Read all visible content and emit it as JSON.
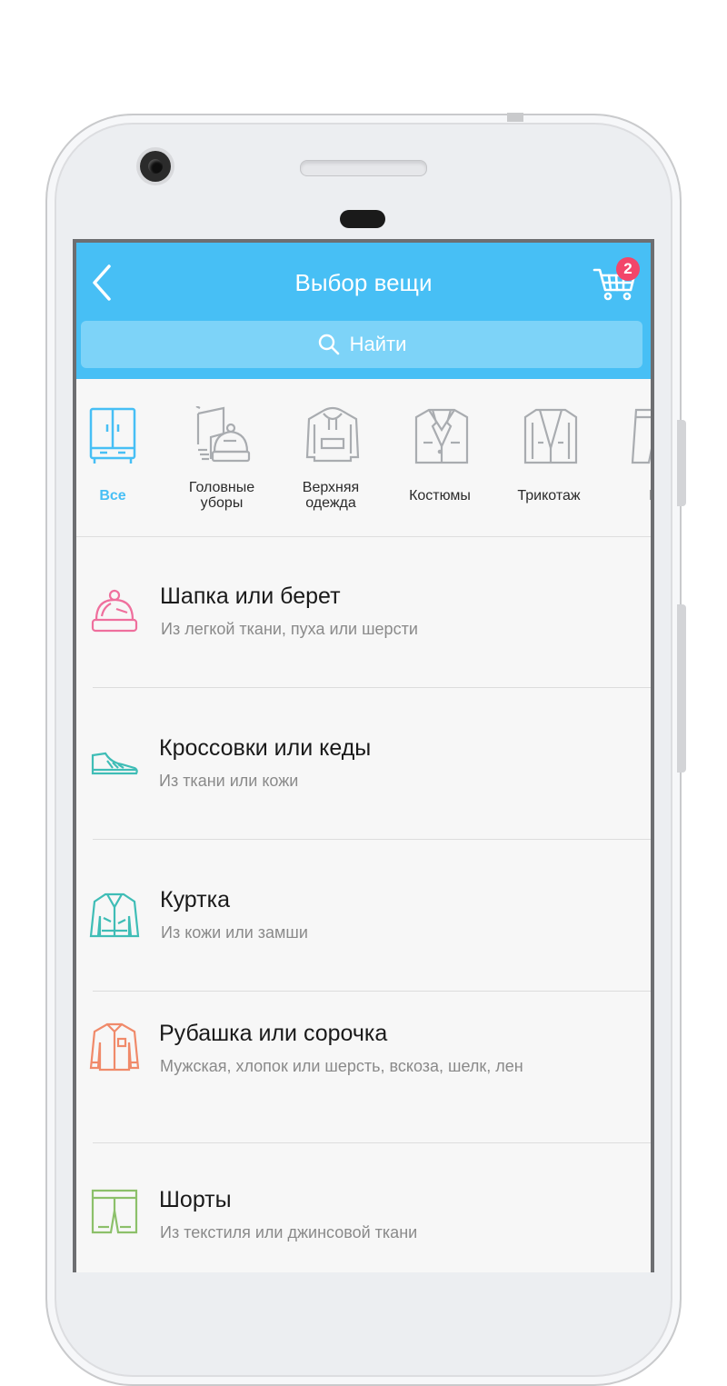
{
  "header": {
    "title": "Выбор вещи",
    "cart_count": "2"
  },
  "search": {
    "placeholder": "Найти"
  },
  "categories": [
    {
      "label": "Все",
      "icon": "wardrobe-icon",
      "active": true
    },
    {
      "label": "Головные\nуборы",
      "icon": "hat-scarf-icon",
      "active": false
    },
    {
      "label": "Верхняя\nодежда",
      "icon": "hoodie-icon",
      "active": false
    },
    {
      "label": "Костюмы",
      "icon": "suit-jacket-icon",
      "active": false
    },
    {
      "label": "Трикотаж",
      "icon": "cardigan-icon",
      "active": false
    },
    {
      "label": "Бр",
      "icon": "trousers-icon",
      "active": false
    }
  ],
  "items": [
    {
      "title": "Шапка или берет",
      "subtitle": "Из легкой ткани, пуха или шерсти",
      "icon": "beanie-icon",
      "color": "#ef6f9d"
    },
    {
      "title": "Кроссовки или кеды",
      "subtitle": "Из ткани или кожи",
      "icon": "sneaker-icon",
      "color": "#3fbdb6"
    },
    {
      "title": "Куртка",
      "subtitle": "Из кожи или замши",
      "icon": "jacket-icon",
      "color": "#3fbdb6"
    },
    {
      "title": "Рубашка или сорочка",
      "subtitle": "Мужская, хлопок или шерсть, вскоза, шелк, лен",
      "icon": "shirt-icon",
      "color": "#f08a6a"
    },
    {
      "title": "Шорты",
      "subtitle": "Из текстиля или джинсовой ткани",
      "icon": "shorts-icon",
      "color": "#8cc06a"
    }
  ],
  "colors": {
    "accent": "#47bff5",
    "badge": "#f2466a",
    "category_icon": "#a9acb0"
  }
}
